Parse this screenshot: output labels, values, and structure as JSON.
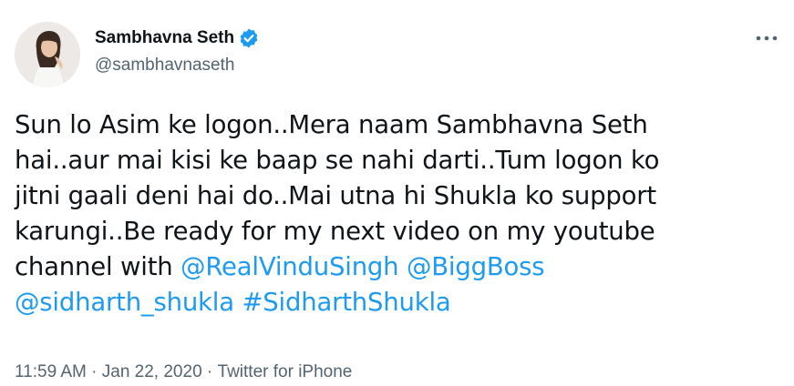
{
  "author": {
    "display_name": "Sambhavna Seth",
    "handle": "@sambhavnaseth",
    "verified": true
  },
  "icons": {
    "verified": "verified-badge-icon",
    "more": "more-options-icon"
  },
  "colors": {
    "link": "#1d9bf0",
    "text": "#0f1419",
    "secondary": "#536471"
  },
  "tweet": {
    "line1": "Sun lo Asim ke logon..Mera naam Sambhavna Seth",
    "line2": "hai..aur mai kisi ke baap se nahi darti..Tum logon ko",
    "line3": "jitni gaali deni hai do..Mai utna hi Shukla ko support",
    "line4": "karungi..Be ready for my next video on my youtube",
    "line5_text": "channel with ",
    "mention1": "@RealVinduSingh",
    "mention2": "@BiggBoss",
    "mention3": "@sidharth_shukla",
    "hashtag1": "#SidharthShukla"
  },
  "meta": {
    "time": "11:59 AM",
    "separator": "·",
    "date": "Jan 22, 2020",
    "source": "Twitter for iPhone"
  }
}
